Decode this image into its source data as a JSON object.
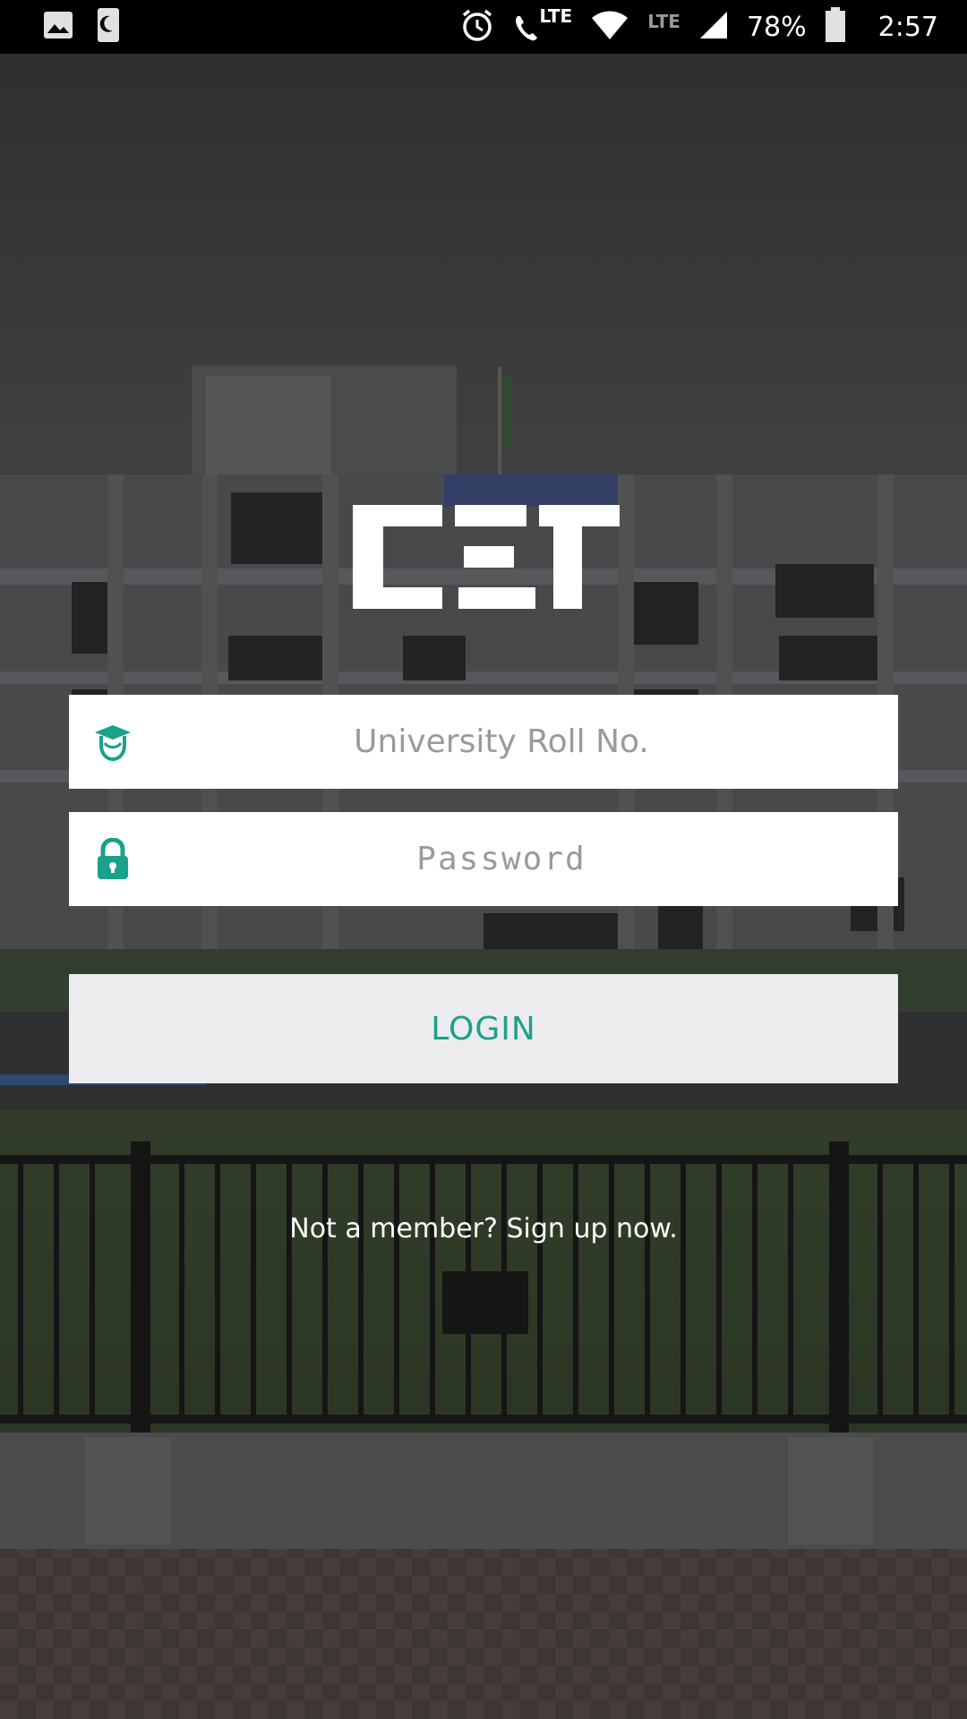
{
  "status_bar": {
    "battery": "78%",
    "time": "2:57",
    "network_primary": "LTE",
    "network_secondary": "LTE"
  },
  "login_form": {
    "roll_placeholder": "University Roll No.",
    "password_placeholder": "Password",
    "login_label": "LOGIN",
    "signup_text": "Not a member? Sign up now."
  },
  "colors": {
    "accent": "#1aa189",
    "input_bg": "#ffffff",
    "button_bg": "#ececee"
  },
  "icons": [
    "image-icon",
    "moon-icon",
    "alarm-icon",
    "call-icon",
    "wifi-icon",
    "signal-icon",
    "battery-icon",
    "graduate-icon",
    "lock-icon"
  ]
}
